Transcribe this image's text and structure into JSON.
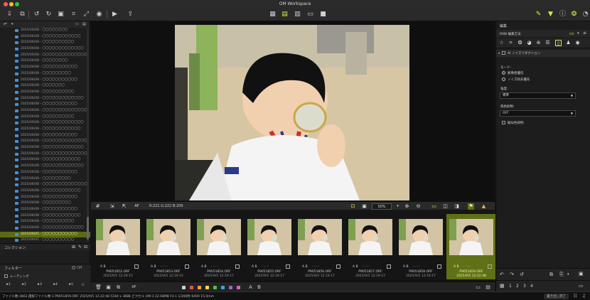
{
  "window": {
    "title": "OM Workspace"
  },
  "colors": {
    "accent": "#d8e84a",
    "selection": "#5f7116"
  },
  "toolbar": {
    "left_icons": [
      "import-icon",
      "copy-icon",
      "rotate-left-icon",
      "rotate-right-icon",
      "compare-icon",
      "crop-icon",
      "resize-icon",
      "camera-icon",
      "play-icon",
      "share-icon"
    ],
    "center_icons": [
      "grid-view-icon",
      "filmstrip-view-icon",
      "raw-view-icon",
      "single-view-icon",
      "fullscreen-icon"
    ],
    "right_icons": [
      "edit-icon",
      "filter-icon",
      "info-icon",
      "color-icon",
      "histogram-icon"
    ]
  },
  "folders": [
    "2025/06/08 - 〇〇〇〇〇〇〇〇",
    "2025/06/08 - 〇〇〇〇〇〇〇〇〇〇〇〇",
    "2025/06/08 - 〇〇〇〇〇〇〇〇〇〇",
    "2025/06/08 - 〇〇〇〇〇〇〇〇〇〇〇〇〇",
    "2025/06/08 - 〇〇〇〇〇〇〇〇〇〇〇〇〇〇",
    "2025/06/08 - 〇〇〇〇〇〇〇〇",
    "2025/06/08 - 〇〇〇〇〇〇〇〇〇〇〇",
    "2025/06/08 - 〇〇〇〇〇〇〇〇〇",
    "2025/06/08 - 〇〇〇〇〇〇〇〇〇〇〇",
    "2025/06/08 - 〇〇〇〇〇〇〇",
    "2025/06/08 - 〇〇〇〇〇〇〇〇〇〇",
    "2025/06/08 - 〇〇〇〇〇〇〇〇〇〇〇〇〇",
    "2025/06/08 - 〇〇〇〇〇〇〇〇〇〇〇",
    "2025/06/08 - 〇〇〇〇〇〇〇〇〇〇〇〇〇〇",
    "2025/06/08 - 〇〇〇〇〇〇〇〇〇〇",
    "2025/06/08 - 〇〇〇〇〇〇〇〇〇〇〇〇〇",
    "2025/06/08 - 〇〇〇〇〇〇〇〇〇〇〇〇",
    "2025/06/08 - 〇〇〇〇〇〇〇〇〇〇〇",
    "2025/06/08 - 〇〇〇〇〇〇〇〇〇〇〇〇〇〇",
    "2025/06/08 - 〇〇〇〇〇〇〇〇〇〇〇〇〇",
    "2025/06/08 - 〇〇〇〇〇〇〇〇〇〇〇〇〇〇",
    "2025/06/08 - 〇〇〇〇〇〇〇〇〇〇〇〇",
    "2025/06/08 - 〇〇〇〇〇〇〇〇〇〇〇〇〇",
    "2025/06/08 - 〇〇〇〇〇〇〇〇〇〇〇",
    "2025/06/08 - 〇〇〇〇〇〇〇〇〇",
    "2025/06/08 - 〇〇〇〇〇〇〇〇〇〇〇〇〇〇",
    "2025/06/08 - 〇〇〇〇〇〇〇〇〇〇〇〇",
    "2025/06/08 - 〇〇〇〇〇〇〇〇〇〇〇",
    "2025/06/08 - 〇〇〇〇〇〇〇〇〇",
    "2025/06/08 - 〇〇〇〇〇〇〇〇〇〇〇",
    "2025/06/08 - 〇〇〇〇〇〇〇〇〇〇〇〇",
    "2025/06/08 - 〇〇〇〇〇〇〇〇〇〇",
    "2025/06/08 - 〇〇〇〇〇〇〇〇〇〇〇〇〇",
    "2025/09/05 - 〇〇〇〇〇〇〇〇〇〇〇",
    "2025/09/05 - 〇〇〇〇〇〇〇〇〇〇"
  ],
  "selected_folder_index": 33,
  "collection": {
    "label": "コレクション"
  },
  "filter": {
    "label": "フィルター",
    "toggle": "Off",
    "rating_label": "レーティング",
    "stars": [
      "★1",
      "★2",
      "★3",
      "★4",
      "★5"
    ]
  },
  "viewbar": {
    "rgb": "R:221 G:222 B:209",
    "af_label": "AF",
    "zoom": "50%"
  },
  "thumbnails": [
    {
      "ab": "A B",
      "dots": "· · · ·",
      "name": "P9051852.ORF",
      "date": "2025/9/5 12:19:15"
    },
    {
      "ab": "A B",
      "dots": "· · · ·",
      "name": "P9051853.ORF",
      "date": "2025/9/5 12:19:15"
    },
    {
      "ab": "A B",
      "dots": "· · · ·",
      "name": "P9051854.ORF",
      "date": "2025/9/5 12:19:17"
    },
    {
      "ab": "A B",
      "dots": "· · · ·",
      "name": "P9051855.ORF",
      "date": "2025/9/5 12:19:17"
    },
    {
      "ab": "A B",
      "dots": "· · · ·",
      "name": "P9051856.ORF",
      "date": "2025/9/5 12:19:17"
    },
    {
      "ab": "A B",
      "dots": "· · · ·",
      "name": "P9051857.ORF",
      "date": "2025/9/5 12:19:17"
    },
    {
      "ab": "A B",
      "dots": "· · · ·",
      "name": "P9051858.ORF",
      "date": "2025/9/5 12:19:17"
    },
    {
      "ab": "A B",
      "dots": "· · · ·",
      "name": "P9051859.ORF",
      "date": "2025/9/5 12:22:48"
    }
  ],
  "selected_thumbnail_index": 7,
  "bottombar": {
    "af_label": "AF",
    "a_label": "A",
    "b_label": "B",
    "color_labels": [
      "#cfcfcf",
      "#e0524f",
      "#f0a030",
      "#f0e040",
      "#50c050",
      "#40a0e0",
      "#a060d0",
      "#e060b0"
    ]
  },
  "right_panel": {
    "title": "編集",
    "subtitle": "RAW 編集方法",
    "section": "AI ノイズリダクション",
    "mode_label": "モード:",
    "mode_options": [
      "解像感優先",
      "ノイズ除去優先"
    ],
    "mode_selected": 0,
    "strength_label": "強度:",
    "strength_value": "標準",
    "false_color_label": "偽色抑制:",
    "false_color_value": "OFF",
    "checkbox_label": "擬似色抑制",
    "page_numbers": [
      "1",
      "2",
      "3",
      "4"
    ]
  },
  "status": {
    "text": "ファイル数:3663   選択ファイル数:1   P9051859.ORF   2025/9/5 12:22:48   5184 x 3888 ピクセル   OM-3   22.68MB   F4.1   1/200秒   6400   15.0mm",
    "right": "書き出し完了"
  }
}
